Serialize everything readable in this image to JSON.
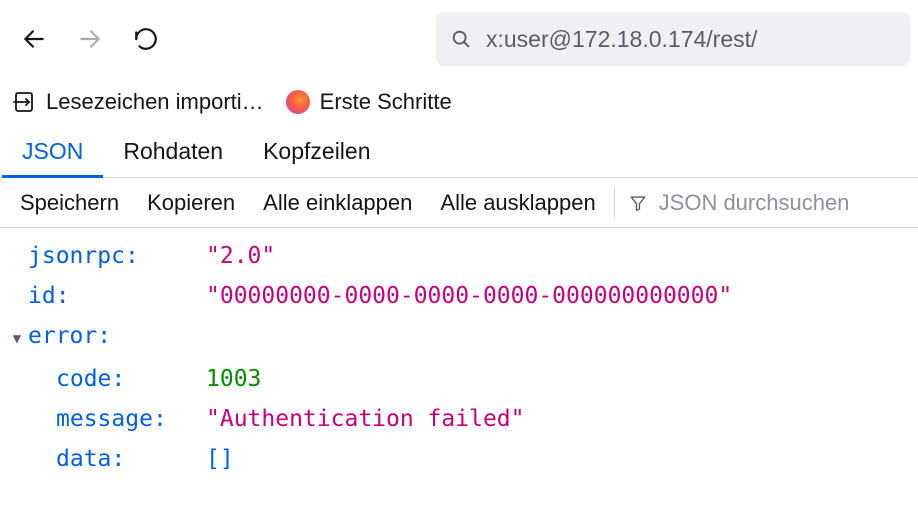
{
  "nav": {
    "url_display": "x:user@172.18.0.174/rest/"
  },
  "bookmarks": {
    "import_label": "Lesezeichen importi…",
    "first_steps_label": "Erste Schritte"
  },
  "tabs": {
    "json": "JSON",
    "raw": "Rohdaten",
    "headers": "Kopfzeilen"
  },
  "toolbar": {
    "save": "Speichern",
    "copy": "Kopieren",
    "collapse_all": "Alle einklappen",
    "expand_all": "Alle ausklappen",
    "search_placeholder": "JSON durchsuchen"
  },
  "json": {
    "keys": {
      "jsonrpc": "jsonrpc",
      "id": "id",
      "error": "error",
      "code": "code",
      "message": "message",
      "data": "data"
    },
    "values": {
      "jsonrpc": "\"2.0\"",
      "id": "\"00000000-0000-0000-0000-000000000000\"",
      "code": "1003",
      "message": "\"Authentication failed\"",
      "data": "[]"
    }
  },
  "chart_data": {
    "type": "table",
    "note": "JSON-RPC error response rendered in browser JSON viewer",
    "payload": {
      "jsonrpc": "2.0",
      "id": "00000000-0000-0000-0000-000000000000",
      "error": {
        "code": 1003,
        "message": "Authentication failed",
        "data": []
      }
    }
  }
}
